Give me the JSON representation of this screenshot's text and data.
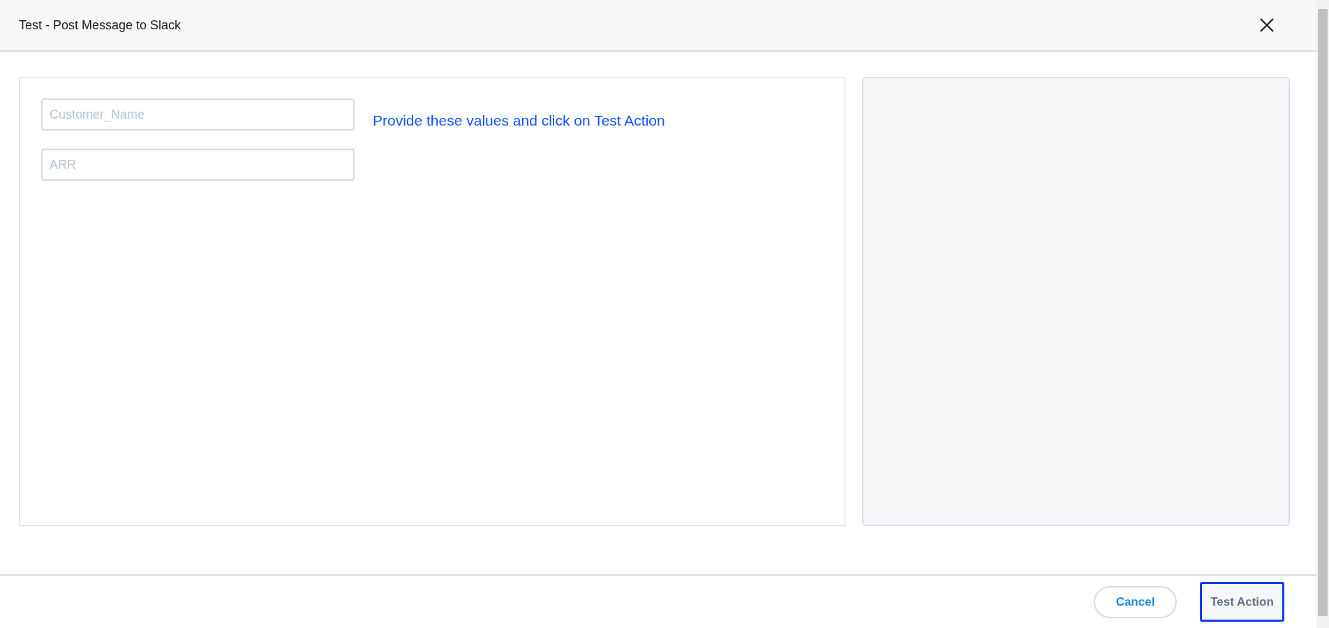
{
  "dialog": {
    "title": "Test - Post Message to Slack"
  },
  "fields": [
    {
      "placeholder": "Customer_Name"
    },
    {
      "placeholder": "ARR"
    }
  ],
  "hint": "Provide these values and click on Test Action",
  "buttons": [
    {
      "label": "Cancel",
      "kind": "secondary",
      "focused": false
    },
    {
      "label": "Test Action",
      "kind": "primary",
      "focused": true
    }
  ]
}
